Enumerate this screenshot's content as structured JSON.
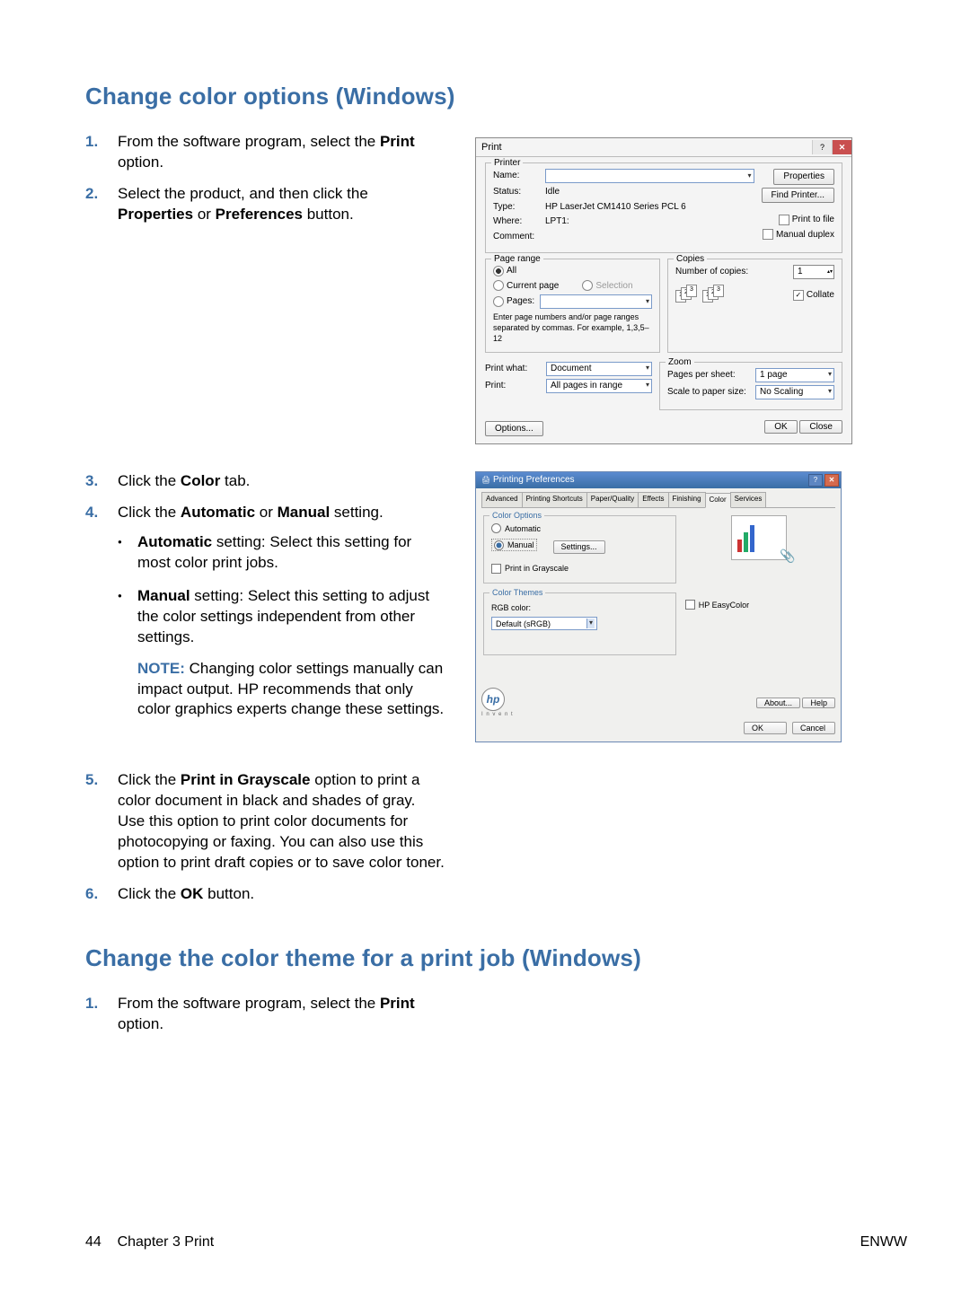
{
  "h1": "Change color options (Windows)",
  "h2": "Change the color theme for a print job (Windows)",
  "steps1": {
    "s1a": "From the software program, select the ",
    "s1b": "Print",
    "s1c": " option.",
    "s2a": "Select the product, and then click the ",
    "s2b": "Properties",
    "s2c": " or ",
    "s2d": "Preferences",
    "s2e": " button.",
    "s3a": "Click the ",
    "s3b": "Color",
    "s3c": " tab.",
    "s4a": "Click the ",
    "s4b": "Automatic",
    "s4c": " or ",
    "s4d": "Manual",
    "s4e": " setting.",
    "b1a": "Automatic",
    "b1b": " setting: Select this setting for most color print jobs.",
    "b2a": "Manual",
    "b2b": " setting: Select this setting to adjust the color settings independent from other settings.",
    "noteLbl": "NOTE:",
    "noteTxt": " Changing color settings manually can impact output. HP recommends that only color graphics experts change these settings.",
    "s5a": "Click the ",
    "s5b": "Print in Grayscale",
    "s5c": " option to print a color document in black and shades of gray. Use this option to print color documents for photocopying or faxing. You can also use this option to print draft copies or to save color toner.",
    "s6a": "Click the ",
    "s6b": "OK",
    "s6c": " button."
  },
  "steps2": {
    "s1a": "From the software program, select the ",
    "s1b": "Print",
    "s1c": " option."
  },
  "print": {
    "title": "Print",
    "grp_printer": "Printer",
    "name": "Name:",
    "status": "Status:",
    "status_v": "Idle",
    "type": "Type:",
    "type_v": "HP LaserJet CM1410 Series PCL 6",
    "where": "Where:",
    "where_v": "LPT1:",
    "comment": "Comment:",
    "properties": "Properties",
    "find": "Find Printer...",
    "ptf": "Print to file",
    "mdx": "Manual duplex",
    "grp_range": "Page range",
    "all": "All",
    "cur": "Current page",
    "selc": "Selection",
    "pages": "Pages:",
    "hint": "Enter page numbers and/or page ranges separated by commas. For example, 1,3,5–12",
    "grp_copies": "Copies",
    "numc": "Number of copies:",
    "copies_v": "1",
    "collate": "Collate",
    "pw": "Print what:",
    "pw_v": "Document",
    "pr": "Print:",
    "pr_v": "All pages in range",
    "grp_zoom": "Zoom",
    "pps": "Pages per sheet:",
    "pps_v": "1 page",
    "sps": "Scale to paper size:",
    "sps_v": "No Scaling",
    "options": "Options...",
    "ok": "OK",
    "close": "Close"
  },
  "pref": {
    "title": "Printing Preferences",
    "tabs": [
      "Advanced",
      "Printing Shortcuts",
      "Paper/Quality",
      "Effects",
      "Finishing",
      "Color",
      "Services"
    ],
    "fs_color": "Color Options",
    "auto": "Automatic",
    "manual": "Manual",
    "settings": "Settings...",
    "gray": "Print in Grayscale",
    "easy": "HP EasyColor",
    "fs_theme": "Color Themes",
    "rgb": "RGB color:",
    "rgb_v": "Default (sRGB)",
    "about": "About...",
    "help": "Help",
    "ok": "OK",
    "cancel": "Cancel",
    "small": "I n v e n t",
    "hp": "hp"
  },
  "footer": {
    "left_page": "44",
    "left_chap": "Chapter 3   Print",
    "right": "ENWW"
  }
}
